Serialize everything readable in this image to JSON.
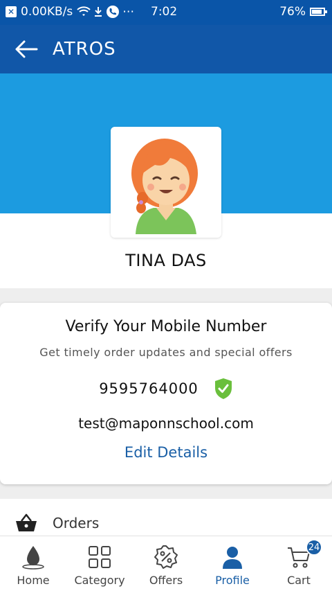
{
  "status_bar": {
    "data_speed": "0.00KB/s",
    "time": "7:02",
    "battery": "76%",
    "battery_level": 0.76,
    "more_glyph": "⋯"
  },
  "app_bar": {
    "title": "ATROS",
    "back_icon": "arrow-left-icon"
  },
  "profile": {
    "name": "TINA DAS",
    "avatar_icon": "girl-avatar-icon"
  },
  "verify": {
    "title": "Verify Your Mobile Number",
    "subtitle": "Get timely order updates and special offers",
    "phone": "9595764000",
    "email": "test@maponnschool.com",
    "edit_label": "Edit Details",
    "verified_icon": "shield-check-icon"
  },
  "orders": {
    "label": "Orders",
    "icon": "basket-icon"
  },
  "bottom_nav": {
    "items": [
      {
        "label": "Home",
        "icon": "droplet-home-icon"
      },
      {
        "label": "Category",
        "icon": "grid-icon"
      },
      {
        "label": "Offers",
        "icon": "percent-badge-icon"
      },
      {
        "label": "Profile",
        "icon": "person-icon"
      },
      {
        "label": "Cart",
        "icon": "cart-icon"
      }
    ],
    "cart_count": "24",
    "active_color": "#1a5fa6"
  },
  "colors": {
    "status_bar": "#0a55a8",
    "app_bar": "#1157a8",
    "banner": "#1c9be0",
    "verified_green": "#6abf3c"
  }
}
